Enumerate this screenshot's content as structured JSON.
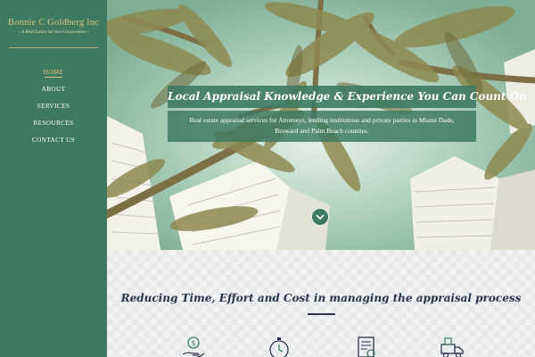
{
  "logo": {
    "name": "Bonnie C Goldberg Inc",
    "tagline": "~ A Real Estate Service Corporation ~"
  },
  "nav": [
    {
      "label": "HOME",
      "active": true
    },
    {
      "label": "ABOUT",
      "active": false
    },
    {
      "label": "SERVICES",
      "active": false
    },
    {
      "label": "RESOURCES",
      "active": false
    },
    {
      "label": "CONTACT US",
      "active": false
    }
  ],
  "hero": {
    "title": "Local Appraisal Knowledge & Experience You Can Count On",
    "subtitle": "Real estate appraisal services for Attorneys, lending institutions and private parties in Miami Dade, Broward and Palm Beach counties.",
    "scroll_icon": "chevron-down-icon"
  },
  "section": {
    "title": "Reducing Time, Effort and Cost in managing the appraisal process",
    "icons": [
      "money-hand-icon",
      "stopwatch-icon",
      "document-certificate-icon",
      "delivery-truck-icon"
    ]
  },
  "colors": {
    "sidebar": "#3e7a62",
    "gold": "#d9c27a",
    "navy": "#27344c",
    "hero_overlay": "#3e7a62"
  }
}
